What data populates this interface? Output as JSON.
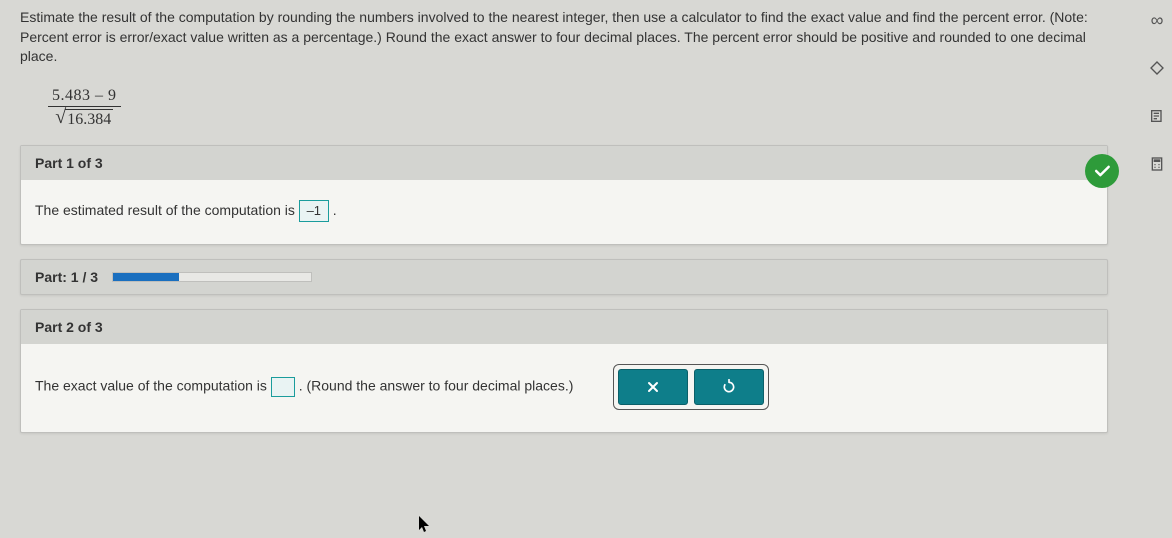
{
  "question": "Estimate the result of the computation by rounding the numbers involved to the nearest integer, then use a calculator to find the exact value and find the percent error. (Note: Percent error is error/exact value written as a percentage.) Round the exact answer to four decimal places. The percent error should be positive and rounded to one decimal place.",
  "formula": {
    "numerator": "5.483 – 9",
    "radicand": "16.384"
  },
  "part1": {
    "header": "Part 1 of 3",
    "text_before": "The estimated result of the computation is ",
    "answer": "–1",
    "text_after": "."
  },
  "progress": {
    "label": "Part: 1 / 3",
    "percent": 33.3
  },
  "part2": {
    "header": "Part 2 of 3",
    "text_before": "The exact value of the computation is ",
    "text_after": ". (Round the answer to four decimal places.)"
  }
}
